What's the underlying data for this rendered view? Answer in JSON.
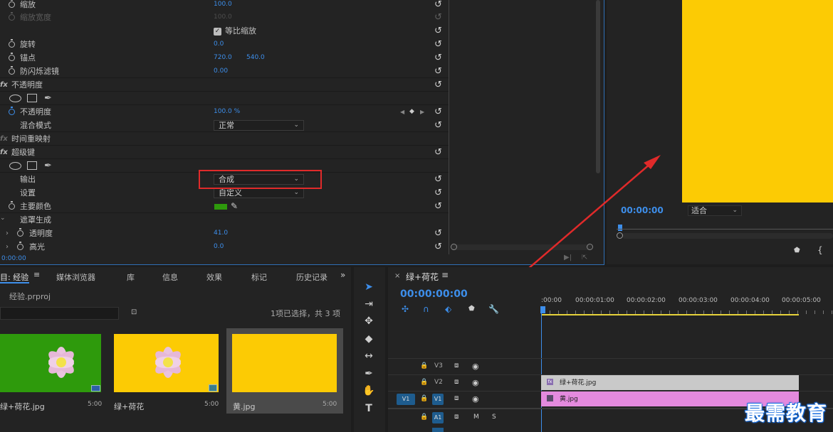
{
  "effect_controls": {
    "rows": [
      {
        "label": "缩放",
        "value": "100.0",
        "dim": false
      },
      {
        "label": "缩放宽度",
        "value": "100.0",
        "dim": true
      },
      {
        "checkbox_label": "等比缩放"
      },
      {
        "label": "旋转",
        "value": "0.0"
      },
      {
        "label": "锚点",
        "value": "720.0",
        "value2": "540.0"
      },
      {
        "label": "防闪烁滤镜",
        "value": "0.00"
      },
      {
        "section": "不透明度"
      },
      {
        "shapes": true
      },
      {
        "label": "不透明度",
        "value": "100.0 %"
      },
      {
        "label": "混合模式",
        "dropdown": "正常"
      },
      {
        "section": "时间重映射"
      },
      {
        "section": "超级键"
      },
      {
        "shapes": true
      },
      {
        "label": "输出",
        "dropdown": "合成"
      },
      {
        "label": "设置",
        "dropdown": "自定义"
      },
      {
        "label": "主要颜色"
      },
      {
        "label": "遮罩生成"
      },
      {
        "label": "透明度",
        "value": "41.0"
      },
      {
        "label": "高光",
        "value": "0.0"
      }
    ],
    "timecode": "0:00:00"
  },
  "program_monitor": {
    "timecode": "00:00:00",
    "fit_label": "适合",
    "frame_color": "#fccb04"
  },
  "project_panel": {
    "tabs": [
      "目: 经验",
      "媒体浏览器",
      "库",
      "信息",
      "效果",
      "标记",
      "历史记录"
    ],
    "project_file": "经验.prproj",
    "selection_info": "1项已选择，共 3 项",
    "items": [
      {
        "name": "绿+荷花.jpg",
        "duration": "5:00"
      },
      {
        "name": "绿+荷花",
        "duration": "5:00"
      },
      {
        "name": "黄.jpg",
        "duration": "5:00"
      }
    ]
  },
  "sequence": {
    "tab_label": "绿+荷花",
    "timecode": "00:00:00:00",
    "ruler": [
      ":00:00",
      "00:00:01:00",
      "00:00:02:00",
      "00:00:03:00",
      "00:00:04:00",
      "00:00:05:00"
    ],
    "tracks": [
      "V3",
      "V2",
      "V1",
      "A1"
    ],
    "source_label": "V1",
    "clip_v2": "绿+荷花.jpg",
    "clip_v1": "黄.jpg"
  },
  "watermark": "最需教育",
  "colors": {
    "accent_blue": "#3d8eea",
    "highlight_red": "#e02a2a",
    "yellow": "#fccb04",
    "green": "#2e9a0c",
    "clip_pink": "#e48ade"
  }
}
